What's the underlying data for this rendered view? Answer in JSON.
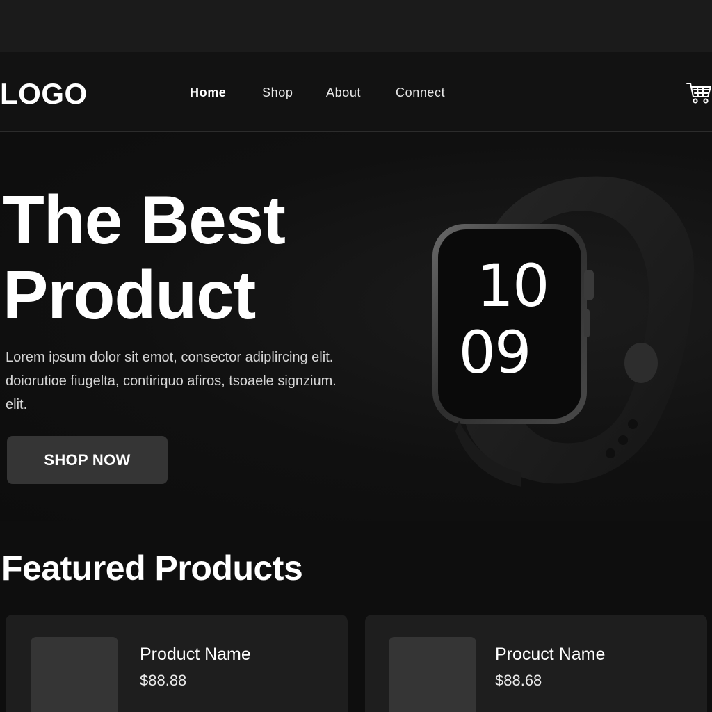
{
  "header": {
    "logo": "LOGO",
    "nav": [
      {
        "label": "Home",
        "active": true
      },
      {
        "label": "Shop",
        "active": false
      },
      {
        "label": "About",
        "active": false
      },
      {
        "label": "Connect",
        "active": false
      }
    ],
    "cart_icon": "cart-icon"
  },
  "hero": {
    "title_line1": "The Best",
    "title_line2": "Product",
    "description_line1": "Lorem ipsum dolor sit emot, consector adiplircing elit.",
    "description_line2": "doiorutioe fiugelta, contiriquo afiros, tsoaele signzium.",
    "description_line3": "elit.",
    "cta_label": "SHOP NOW",
    "watch": {
      "time_hour": "10",
      "time_minute": "09"
    }
  },
  "featured": {
    "title": "Featured Products",
    "products": [
      {
        "name": "Product Name",
        "price": "$88.88"
      },
      {
        "name": "Procuct Name",
        "price": "$88.68"
      }
    ]
  },
  "colors": {
    "background": "#0e0e0e",
    "card": "#1e1e1e",
    "button": "#353535",
    "text": "#ffffff"
  }
}
